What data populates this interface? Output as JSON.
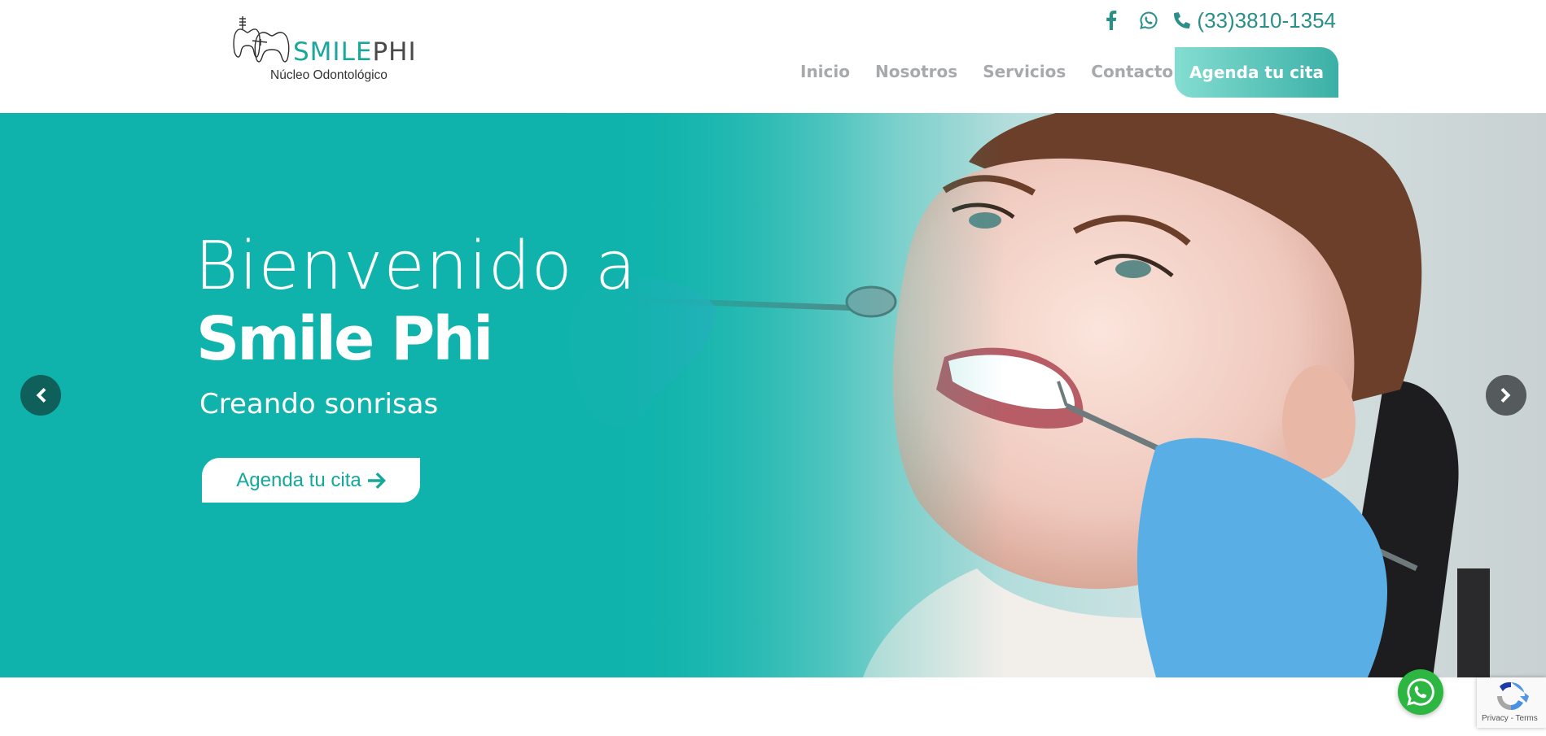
{
  "brand": {
    "logo_smile": "SMILE",
    "logo_phi": "PHI",
    "tagline": "Núcleo Odontológico"
  },
  "topbar": {
    "phone": "(33)3810-1354",
    "icons": [
      "facebook-icon",
      "whatsapp-icon",
      "phone-icon"
    ]
  },
  "nav": {
    "items": [
      "Inicio",
      "Nosotros",
      "Servicios",
      "Contacto"
    ],
    "cta": "Agenda tu cita"
  },
  "hero": {
    "title_line1": "Bienvenido a",
    "title_line2": "Smile Phi",
    "subtitle": "Creando sonrisas",
    "cta": "Agenda tu cita"
  },
  "recaptcha": {
    "privacy": "Privacy",
    "separator": "-",
    "terms": "Terms"
  },
  "colors": {
    "brand_teal": "#1aa79c",
    "hero_teal": "#12b5ad",
    "nav_gray": "#a7a9ac",
    "whatsapp_green": "#2db742"
  }
}
